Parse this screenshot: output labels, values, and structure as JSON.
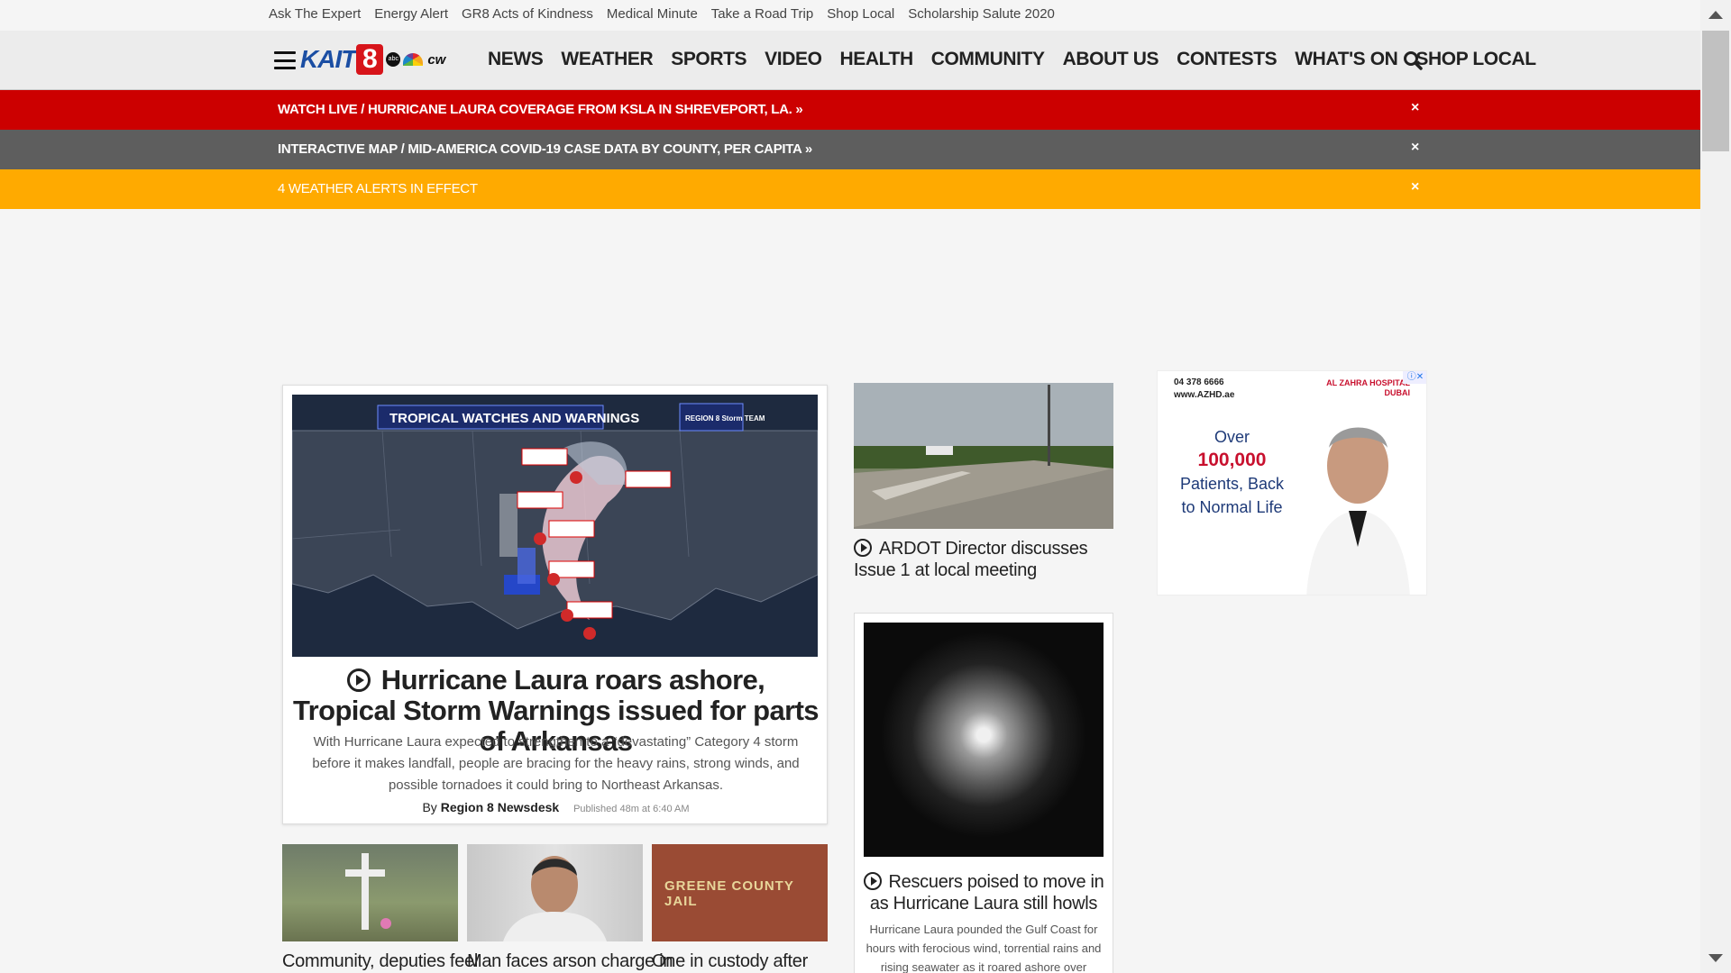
{
  "utility_links": [
    "Ask The Expert",
    "Energy Alert",
    "GR8 Acts of Kindness",
    "Medical Minute",
    "Take a Road Trip",
    "Shop Local",
    "Scholarship Salute 2020"
  ],
  "logo": {
    "name": "KAIT",
    "number": "8",
    "networks": [
      "abc",
      "nbc",
      "cw"
    ]
  },
  "nav_items": [
    "NEWS",
    "WEATHER",
    "SPORTS",
    "VIDEO",
    "HEALTH",
    "COMMUNITY",
    "ABOUT US",
    "CONTESTS",
    "WHAT'S ON",
    "SHOP LOCAL"
  ],
  "alerts": [
    {
      "text": "WATCH LIVE / HURRICANE LAURA COVERAGE FROM KSLA IN SHREVEPORT, LA. »",
      "color": "#cc0000"
    },
    {
      "text": "INTERACTIVE MAP / MID-AMERICA COVID-19 CASE DATA BY COUNTY, PER CAPITA »",
      "color": "#5e5e5e"
    },
    {
      "text": "4 WEATHER ALERTS IN EFFECT",
      "color": "#ffaa00"
    }
  ],
  "close_glyph": "×",
  "feature": {
    "map_title": "TROPICAL WATCHES AND WARNINGS",
    "map_badge": "REGION 8 Storm TEAM",
    "headline": "Hurricane Laura roars ashore, Tropical Storm Warnings issued for parts of Arkansas",
    "summary": "With Hurricane Laura expected to strengthen to a “devastating” Category 4 storm before it makes landfall, people are bracing for the heavy rains, strong winds, and possible tornadoes it could bring to Northeast Arkansas.",
    "by_prefix": "By",
    "author": "Region 8 Newsdesk",
    "published": "Published 48m at 6:40 AM"
  },
  "side_story": {
    "headline": "ARDOT Director discusses Issue 1 at local meeting"
  },
  "side_story2": {
    "headline": "Rescuers poised to move in as Hurricane Laura still howls",
    "summary": "Hurricane Laura pounded the Gulf Coast for hours with ferocious wind, torrential rains and rising seawater as it roared ashore over southwestern"
  },
  "ad": {
    "phone": "04 378 6666",
    "site": "www.AZHD.ae",
    "hospital": "AL ZAHRA HOSPITAL DUBAI",
    "line1": "Over",
    "line2": "100,000",
    "line3": "Patients, Back",
    "line4": "to Normal Life"
  },
  "bottom_stories": [
    {
      "headline": "Community, deputies feel"
    },
    {
      "headline": "Man faces arson charge in"
    },
    {
      "headline": "One in custody after",
      "sign": "GREENE COUNTY JAIL"
    }
  ]
}
